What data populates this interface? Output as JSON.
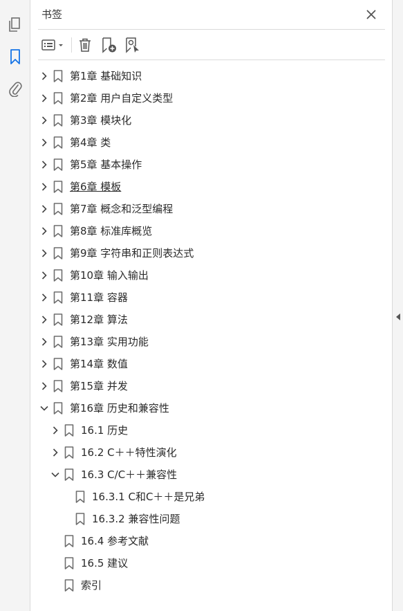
{
  "panel": {
    "title": "书签"
  },
  "toolbar": {
    "options_icon": "options-list-icon",
    "delete_icon": "trash-icon",
    "new_bookmark_icon": "new-bookmark-icon",
    "find_bookmark_icon": "find-bookmark-icon"
  },
  "bookmarks": [
    {
      "label": "第1章 基础知识",
      "level": 0,
      "state": "collapsed"
    },
    {
      "label": "第2章 用户自定义类型",
      "level": 0,
      "state": "collapsed"
    },
    {
      "label": "第3章 模块化",
      "level": 0,
      "state": "collapsed"
    },
    {
      "label": "第4章 类",
      "level": 0,
      "state": "collapsed"
    },
    {
      "label": "第5章 基本操作",
      "level": 0,
      "state": "collapsed"
    },
    {
      "label": "第6章 模板",
      "level": 0,
      "state": "collapsed",
      "underlined": true
    },
    {
      "label": "第7章 概念和泛型编程",
      "level": 0,
      "state": "collapsed"
    },
    {
      "label": "第8章 标准库概览",
      "level": 0,
      "state": "collapsed"
    },
    {
      "label": "第9章 字符串和正则表达式",
      "level": 0,
      "state": "collapsed"
    },
    {
      "label": "第10章 输入输出",
      "level": 0,
      "state": "collapsed"
    },
    {
      "label": "第11章 容器",
      "level": 0,
      "state": "collapsed"
    },
    {
      "label": "第12章 算法",
      "level": 0,
      "state": "collapsed"
    },
    {
      "label": "第13章 实用功能",
      "level": 0,
      "state": "collapsed"
    },
    {
      "label": "第14章 数值",
      "level": 0,
      "state": "collapsed"
    },
    {
      "label": "第15章 并发",
      "level": 0,
      "state": "collapsed"
    },
    {
      "label": "第16章 历史和兼容性",
      "level": 0,
      "state": "expanded"
    },
    {
      "label": "16.1 历史",
      "level": 1,
      "state": "collapsed"
    },
    {
      "label": "16.2 C＋＋特性演化",
      "level": 1,
      "state": "collapsed"
    },
    {
      "label": "16.3 C/C＋＋兼容性",
      "level": 1,
      "state": "expanded"
    },
    {
      "label": "16.3.1 C和C＋＋是兄弟",
      "level": 2,
      "state": "leaf"
    },
    {
      "label": "16.3.2 兼容性问题",
      "level": 2,
      "state": "leaf"
    },
    {
      "label": "16.4 参考文献",
      "level": 1,
      "state": "leaf"
    },
    {
      "label": "16.5 建议",
      "level": 1,
      "state": "leaf"
    },
    {
      "label": "索引",
      "level": 1,
      "state": "leaf"
    }
  ],
  "colors": {
    "accent": "#1473e6",
    "icon": "#6e6e6e",
    "divider": "#dadada"
  }
}
